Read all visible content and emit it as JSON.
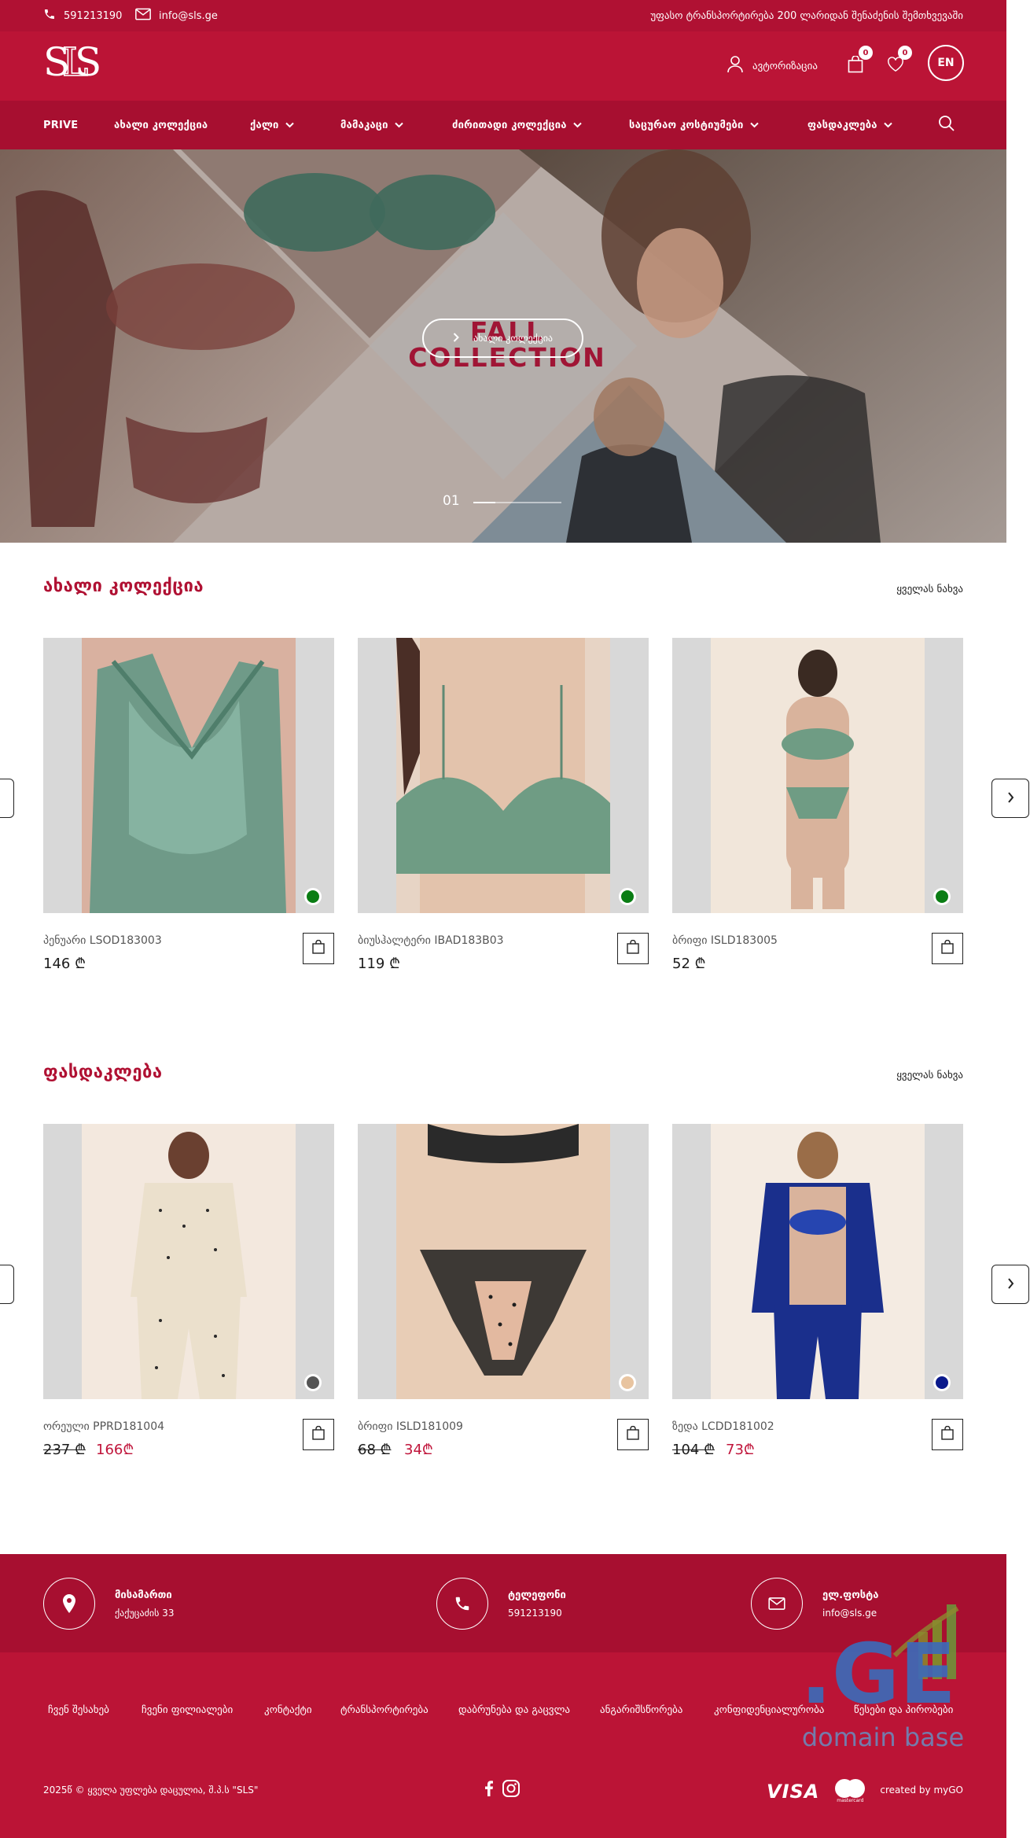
{
  "topbar": {
    "phone": "591213190",
    "email": "info@sls.ge",
    "shipping_note": "უფასო ტრანსპორტირება 200 ლარიდან შენაძენის შემთხვევაში"
  },
  "header": {
    "logo_text": "SLS",
    "login_label": "ავტორიზაცია",
    "cart_count": "0",
    "wishlist_count": "0",
    "lang_label": "EN"
  },
  "nav": {
    "items": [
      {
        "label": "PRIVE",
        "has_dropdown": false
      },
      {
        "label": "ახალი კოლექცია",
        "has_dropdown": false
      },
      {
        "label": "ქალი",
        "has_dropdown": true
      },
      {
        "label": "მამაკაცი",
        "has_dropdown": true
      },
      {
        "label": "ძირითადი კოლექცია",
        "has_dropdown": true
      },
      {
        "label": "საცურაო კოსტიუმები",
        "has_dropdown": true
      },
      {
        "label": "ფასდაკლება",
        "has_dropdown": true
      }
    ]
  },
  "hero": {
    "button_label": "ახალი კოლექცია",
    "headline_line1": "FALL",
    "headline_line2": "COLLECTION",
    "slide_index": "01",
    "slide_progress": 0.25
  },
  "new_collection": {
    "title": "ახალი კოლექცია",
    "view_all": "ყველას ნახვა",
    "products": [
      {
        "name": "პენუარი LSOD183003",
        "price": "146 ₾",
        "swatch": "#0a7d14",
        "bg": "#7fa897"
      },
      {
        "name": "ბიუსჰალტერი IBAD183B03",
        "price": "119 ₾",
        "swatch": "#0a7d14",
        "bg": "#e9dccd"
      },
      {
        "name": "ბრიფი ISLD183005",
        "price": "52 ₾",
        "swatch": "#0a7d14",
        "bg": "#f1e6d9"
      }
    ]
  },
  "sale": {
    "title": "ფასდაკლება",
    "view_all": "ყველას ნახვა",
    "products": [
      {
        "name": "ორეული PPRD181004",
        "old_price": "237 ₾",
        "new_price": "166₾",
        "swatch": "#555555",
        "bg": "#efe5da"
      },
      {
        "name": "ბრიფი ISLD181009",
        "old_price": "68 ₾",
        "new_price": "34₾",
        "swatch": "#e8c4a0",
        "bg": "#f3e5d8"
      },
      {
        "name": "ზედა LCDD181002",
        "old_price": "104 ₾",
        "new_price": "73₾",
        "swatch": "#0b1a8c",
        "bg": "#f2e9e0"
      }
    ]
  },
  "footer": {
    "address_title": "მისამართი",
    "address_value": "ქაქუცაძის 33",
    "phone_title": "ტელეფონი",
    "phone_value": "591213190",
    "email_title": "ელ.ფოსტა",
    "email_value": "info@sls.ge",
    "links": [
      "ჩვენ შესახებ",
      "ჩვენი ფილიალები",
      "კონტაქტი",
      "ტრანსპორტირება",
      "დაბრუნება და გაცვლა",
      "ანგარიშსწორება",
      "კონფიდენციალურობა",
      "წესები და პირობები"
    ],
    "copyright": "2025წ © ყველა უფლება დაცულია,    შ.პ.ს \"SLS\"",
    "created_by": "created by myGO",
    "payment_visa": "VISA",
    "payment_mc": "mastercard"
  },
  "watermark": {
    "text_ge": ".GE",
    "text_sub": "domain base"
  },
  "colors": {
    "brand": "#bb1436",
    "brand_dark": "#a70f30",
    "price_sale": "#c0153b"
  }
}
